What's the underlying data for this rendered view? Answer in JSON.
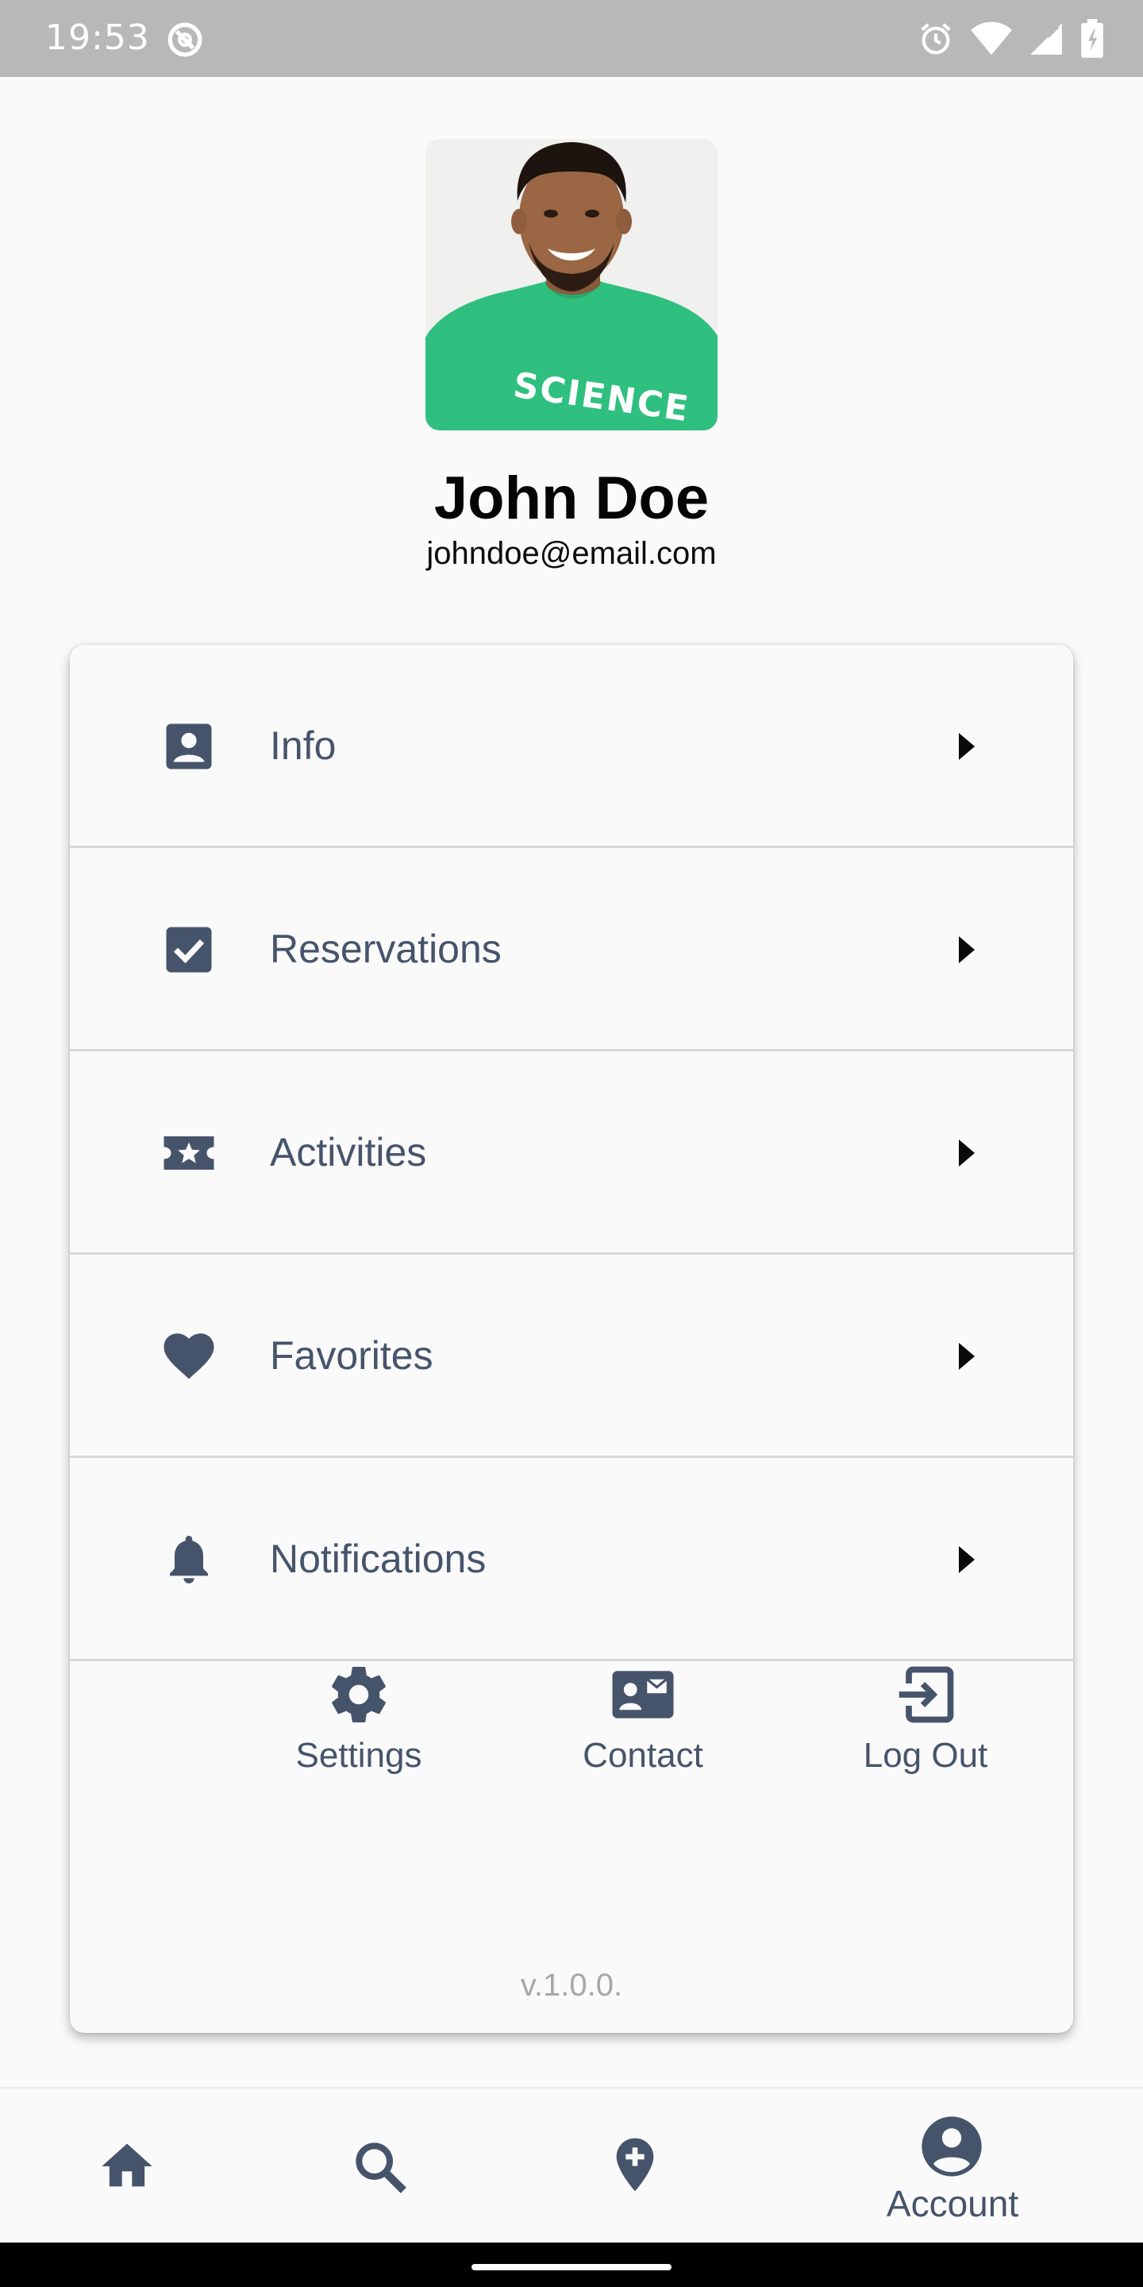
{
  "status_bar": {
    "time": "19:53"
  },
  "profile": {
    "name": "John Doe",
    "email": "johndoe@email.com",
    "shirt_text": "SCIENCE"
  },
  "menu": {
    "items": [
      {
        "label": "Info",
        "icon": "account-box-icon"
      },
      {
        "label": "Reservations",
        "icon": "checkbox-icon"
      },
      {
        "label": "Activities",
        "icon": "ticket-star-icon"
      },
      {
        "label": "Favorites",
        "icon": "heart-icon"
      },
      {
        "label": "Notifications",
        "icon": "bell-icon"
      }
    ]
  },
  "quick_actions": [
    {
      "label": "Settings",
      "icon": "gear-icon"
    },
    {
      "label": "Contact",
      "icon": "contact-card-icon"
    },
    {
      "label": "Log Out",
      "icon": "logout-icon"
    }
  ],
  "version": "v.1.0.0.",
  "bottom_nav": {
    "items": [
      {
        "icon": "home-icon"
      },
      {
        "icon": "search-icon"
      },
      {
        "icon": "add-location-icon"
      },
      {
        "icon": "account-circle-icon",
        "label": "Account",
        "active": true
      }
    ]
  },
  "colors": {
    "accent": "#46546b",
    "background": "#fafafa",
    "status_bar": "#b8b8b8",
    "shirt": "#2fbf7f"
  }
}
